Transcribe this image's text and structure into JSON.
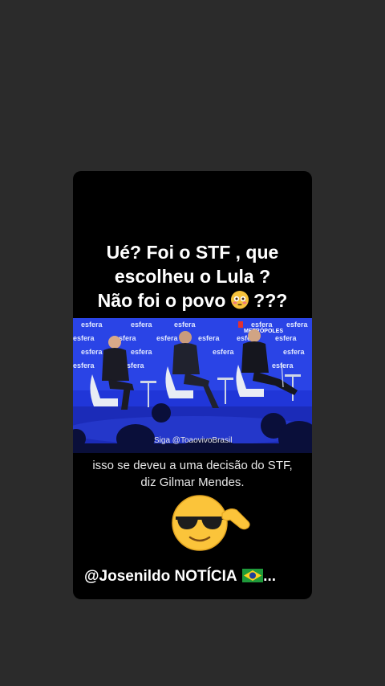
{
  "story": {
    "headline_line1": "Ué? Foi o STF , que",
    "headline_line2": "escolheu o Lula ?",
    "headline_line3_prefix": "Não foi o povo ",
    "headline_line3_suffix": " ???",
    "headline_emoji": "flushed-face-icon",
    "video": {
      "watermark": "Siga @ToaovivoBrasil",
      "backdrop_brand": "esfera",
      "logo_text": "METRÓPOLES"
    },
    "caption_line1": "isso se deveu a uma decisão do STF,",
    "caption_line2": "diz Gilmar Mendes.",
    "reaction_emoji": "sunglasses-face-icon",
    "footer_text": "@Josenildo NOTÍCIA ",
    "footer_suffix": "...",
    "footer_emoji": "brazil-flag-icon"
  },
  "colors": {
    "page_background": "#2b2b2b",
    "card_background": "#000000",
    "video_backdrop": "#1c2fd0",
    "text": "#ffffff"
  }
}
